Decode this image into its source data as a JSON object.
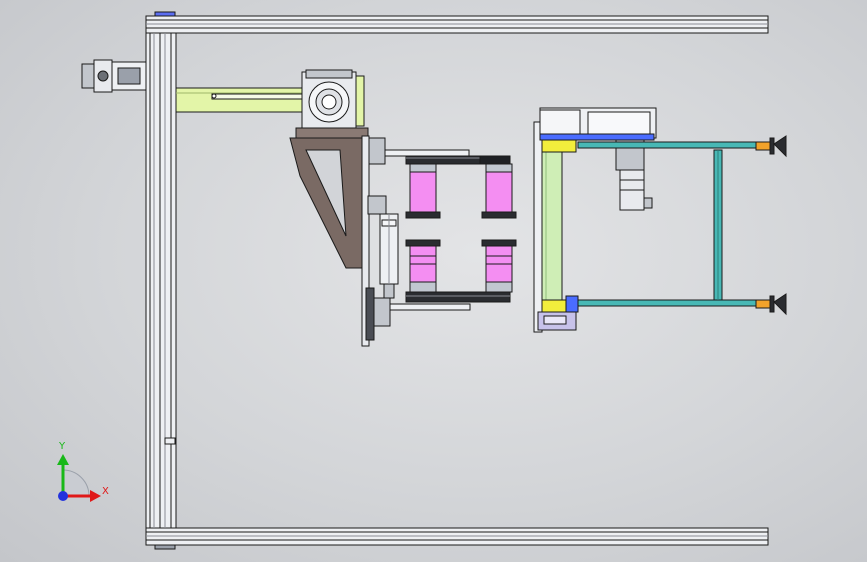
{
  "viewport": {
    "background": "#d6d7da"
  },
  "colors": {
    "frame_profile": "#eef0f3",
    "frame_line": "#1a1a1a",
    "frame_dark": "#7d8088",
    "slide_arm": "#e3f5a8",
    "bracket_brown": "#7a6a64",
    "gripper_pad": "#f48ef2",
    "gripper_band": "#c1c7d0",
    "cyan_rail": "#48b8b5",
    "lime_plate": "#cfeeb6",
    "yellow_block": "#f2ee3c",
    "blue_block": "#4a6cff",
    "lavender_block": "#c7c2ea",
    "motor_grey": "#c2c6cc"
  },
  "triad": {
    "x_label": "X",
    "y_label": "Y",
    "x_color": "#e01818",
    "y_color": "#18b818",
    "origin_color": "#2233dd"
  }
}
